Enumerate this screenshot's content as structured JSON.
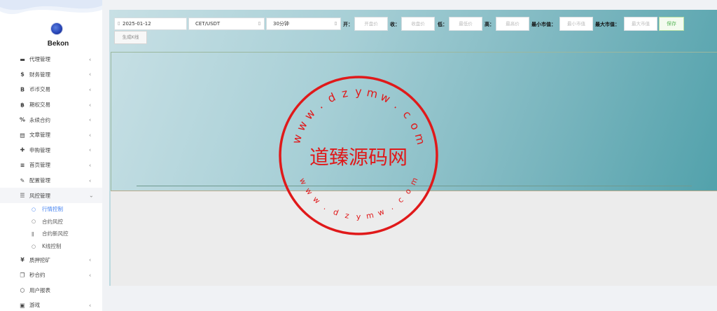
{
  "brand": {
    "name": "Bekon"
  },
  "menu": [
    {
      "icon": "▬",
      "icon_name": "card-icon",
      "label": "代理管理",
      "arrow": "‹"
    },
    {
      "icon": "$",
      "icon_name": "dollar-icon",
      "label": "财务管理",
      "arrow": "‹"
    },
    {
      "icon": "B",
      "icon_name": "bitcoin-icon",
      "label": "币币交易",
      "arrow": "‹"
    },
    {
      "icon": "฿",
      "icon_name": "bitcoin-alt-icon",
      "label": "期权交易",
      "arrow": "‹"
    },
    {
      "icon": "%",
      "icon_name": "link-icon",
      "label": "永续合约",
      "arrow": "‹"
    },
    {
      "icon": "▤",
      "icon_name": "keyboard-icon",
      "label": "文章管理",
      "arrow": "‹"
    },
    {
      "icon": "✚",
      "icon_name": "lifebuoy-icon",
      "label": "申购管理",
      "arrow": "‹"
    },
    {
      "icon": "≡",
      "icon_name": "list-icon",
      "label": "首页管理",
      "arrow": "‹"
    },
    {
      "icon": "✎",
      "icon_name": "wrench-icon",
      "label": "配置管理",
      "arrow": "‹"
    },
    {
      "icon": "☰",
      "icon_name": "list-alt-icon",
      "label": "风控管理",
      "arrow": "⌄"
    }
  ],
  "submenu": [
    {
      "icon": "○",
      "label": "行情控制",
      "active": true
    },
    {
      "icon": "○",
      "label": "合约风控",
      "active": false
    },
    {
      "icon": "ǁ",
      "label": "合约新风控",
      "active": false
    },
    {
      "icon": "○",
      "label": "K线控制",
      "active": false
    }
  ],
  "menu_after": [
    {
      "icon": "¥",
      "icon_name": "yen-icon",
      "label": "质押挖矿",
      "arrow": "‹"
    },
    {
      "icon": "❐",
      "icon_name": "copy-icon",
      "label": "秒合约",
      "arrow": "‹"
    },
    {
      "icon": "○",
      "icon_name": "circle-icon",
      "label": "用户报表",
      "arrow": ""
    },
    {
      "icon": "▣",
      "icon_name": "square-icon",
      "label": "游戏",
      "arrow": "‹"
    }
  ],
  "toolbar": {
    "date": "2025-01-12",
    "pair": "CET/USDT",
    "interval": "30分钟",
    "open_label": "开：",
    "open_placeholder": "开盘价",
    "close_label": "收：",
    "close_placeholder": "收盘价",
    "low_label": "低：",
    "low_placeholder": "最低价",
    "high_label": "高：",
    "high_placeholder": "最高价",
    "min_cap_label": "最小市值：",
    "min_cap_placeholder": "最小市值",
    "max_cap_label": "最大市值：",
    "max_cap_placeholder": "最大市值",
    "save_label": "保存",
    "generate_label": "生成K线"
  },
  "watermark": {
    "text": "道臻源码网",
    "url": "www.dzymw.com"
  },
  "colors": {
    "stamp": "#e0191a",
    "active": "#3d7df0",
    "save": "#5cb85c"
  }
}
